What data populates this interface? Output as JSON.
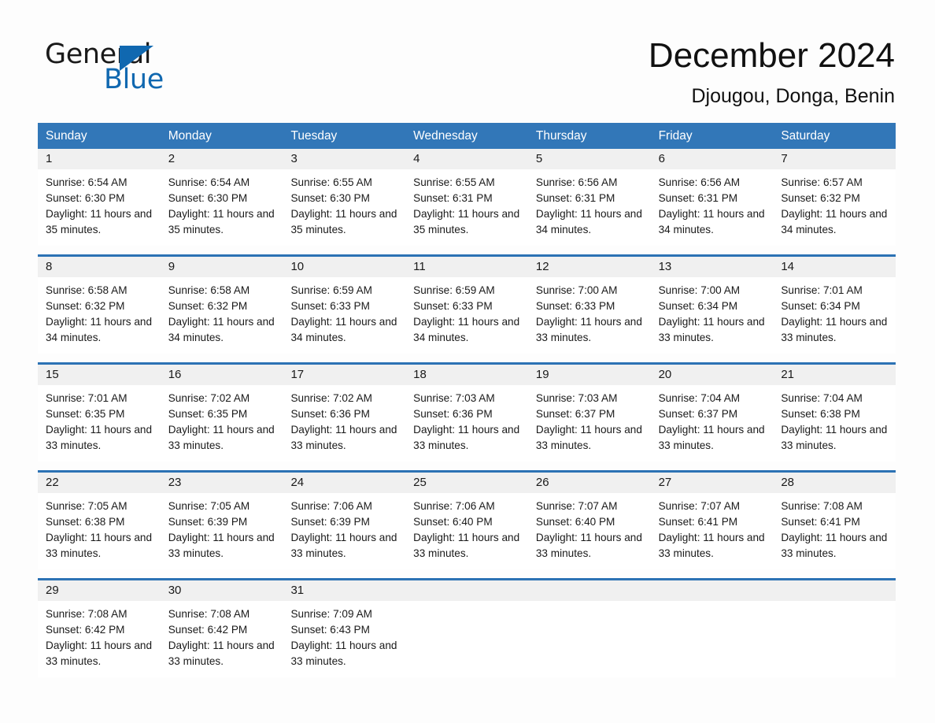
{
  "brand": {
    "word_one": "General",
    "word_two": "Blue",
    "triangle_color": "#1068b0"
  },
  "header": {
    "title": "December 2024",
    "subtitle": "Djougou, Donga, Benin",
    "header_color": "#3277b8"
  },
  "calendar": {
    "weekdays": [
      "Sunday",
      "Monday",
      "Tuesday",
      "Wednesday",
      "Thursday",
      "Friday",
      "Saturday"
    ],
    "weeks": [
      [
        {
          "day": "1",
          "sunrise": "Sunrise: 6:54 AM",
          "sunset": "Sunset: 6:30 PM",
          "daylight": "Daylight: 11 hours and 35 minutes."
        },
        {
          "day": "2",
          "sunrise": "Sunrise: 6:54 AM",
          "sunset": "Sunset: 6:30 PM",
          "daylight": "Daylight: 11 hours and 35 minutes."
        },
        {
          "day": "3",
          "sunrise": "Sunrise: 6:55 AM",
          "sunset": "Sunset: 6:30 PM",
          "daylight": "Daylight: 11 hours and 35 minutes."
        },
        {
          "day": "4",
          "sunrise": "Sunrise: 6:55 AM",
          "sunset": "Sunset: 6:31 PM",
          "daylight": "Daylight: 11 hours and 35 minutes."
        },
        {
          "day": "5",
          "sunrise": "Sunrise: 6:56 AM",
          "sunset": "Sunset: 6:31 PM",
          "daylight": "Daylight: 11 hours and 34 minutes."
        },
        {
          "day": "6",
          "sunrise": "Sunrise: 6:56 AM",
          "sunset": "Sunset: 6:31 PM",
          "daylight": "Daylight: 11 hours and 34 minutes."
        },
        {
          "day": "7",
          "sunrise": "Sunrise: 6:57 AM",
          "sunset": "Sunset: 6:32 PM",
          "daylight": "Daylight: 11 hours and 34 minutes."
        }
      ],
      [
        {
          "day": "8",
          "sunrise": "Sunrise: 6:58 AM",
          "sunset": "Sunset: 6:32 PM",
          "daylight": "Daylight: 11 hours and 34 minutes."
        },
        {
          "day": "9",
          "sunrise": "Sunrise: 6:58 AM",
          "sunset": "Sunset: 6:32 PM",
          "daylight": "Daylight: 11 hours and 34 minutes."
        },
        {
          "day": "10",
          "sunrise": "Sunrise: 6:59 AM",
          "sunset": "Sunset: 6:33 PM",
          "daylight": "Daylight: 11 hours and 34 minutes."
        },
        {
          "day": "11",
          "sunrise": "Sunrise: 6:59 AM",
          "sunset": "Sunset: 6:33 PM",
          "daylight": "Daylight: 11 hours and 34 minutes."
        },
        {
          "day": "12",
          "sunrise": "Sunrise: 7:00 AM",
          "sunset": "Sunset: 6:33 PM",
          "daylight": "Daylight: 11 hours and 33 minutes."
        },
        {
          "day": "13",
          "sunrise": "Sunrise: 7:00 AM",
          "sunset": "Sunset: 6:34 PM",
          "daylight": "Daylight: 11 hours and 33 minutes."
        },
        {
          "day": "14",
          "sunrise": "Sunrise: 7:01 AM",
          "sunset": "Sunset: 6:34 PM",
          "daylight": "Daylight: 11 hours and 33 minutes."
        }
      ],
      [
        {
          "day": "15",
          "sunrise": "Sunrise: 7:01 AM",
          "sunset": "Sunset: 6:35 PM",
          "daylight": "Daylight: 11 hours and 33 minutes."
        },
        {
          "day": "16",
          "sunrise": "Sunrise: 7:02 AM",
          "sunset": "Sunset: 6:35 PM",
          "daylight": "Daylight: 11 hours and 33 minutes."
        },
        {
          "day": "17",
          "sunrise": "Sunrise: 7:02 AM",
          "sunset": "Sunset: 6:36 PM",
          "daylight": "Daylight: 11 hours and 33 minutes."
        },
        {
          "day": "18",
          "sunrise": "Sunrise: 7:03 AM",
          "sunset": "Sunset: 6:36 PM",
          "daylight": "Daylight: 11 hours and 33 minutes."
        },
        {
          "day": "19",
          "sunrise": "Sunrise: 7:03 AM",
          "sunset": "Sunset: 6:37 PM",
          "daylight": "Daylight: 11 hours and 33 minutes."
        },
        {
          "day": "20",
          "sunrise": "Sunrise: 7:04 AM",
          "sunset": "Sunset: 6:37 PM",
          "daylight": "Daylight: 11 hours and 33 minutes."
        },
        {
          "day": "21",
          "sunrise": "Sunrise: 7:04 AM",
          "sunset": "Sunset: 6:38 PM",
          "daylight": "Daylight: 11 hours and 33 minutes."
        }
      ],
      [
        {
          "day": "22",
          "sunrise": "Sunrise: 7:05 AM",
          "sunset": "Sunset: 6:38 PM",
          "daylight": "Daylight: 11 hours and 33 minutes."
        },
        {
          "day": "23",
          "sunrise": "Sunrise: 7:05 AM",
          "sunset": "Sunset: 6:39 PM",
          "daylight": "Daylight: 11 hours and 33 minutes."
        },
        {
          "day": "24",
          "sunrise": "Sunrise: 7:06 AM",
          "sunset": "Sunset: 6:39 PM",
          "daylight": "Daylight: 11 hours and 33 minutes."
        },
        {
          "day": "25",
          "sunrise": "Sunrise: 7:06 AM",
          "sunset": "Sunset: 6:40 PM",
          "daylight": "Daylight: 11 hours and 33 minutes."
        },
        {
          "day": "26",
          "sunrise": "Sunrise: 7:07 AM",
          "sunset": "Sunset: 6:40 PM",
          "daylight": "Daylight: 11 hours and 33 minutes."
        },
        {
          "day": "27",
          "sunrise": "Sunrise: 7:07 AM",
          "sunset": "Sunset: 6:41 PM",
          "daylight": "Daylight: 11 hours and 33 minutes."
        },
        {
          "day": "28",
          "sunrise": "Sunrise: 7:08 AM",
          "sunset": "Sunset: 6:41 PM",
          "daylight": "Daylight: 11 hours and 33 minutes."
        }
      ],
      [
        {
          "day": "29",
          "sunrise": "Sunrise: 7:08 AM",
          "sunset": "Sunset: 6:42 PM",
          "daylight": "Daylight: 11 hours and 33 minutes."
        },
        {
          "day": "30",
          "sunrise": "Sunrise: 7:08 AM",
          "sunset": "Sunset: 6:42 PM",
          "daylight": "Daylight: 11 hours and 33 minutes."
        },
        {
          "day": "31",
          "sunrise": "Sunrise: 7:09 AM",
          "sunset": "Sunset: 6:43 PM",
          "daylight": "Daylight: 11 hours and 33 minutes."
        },
        {
          "day": "",
          "sunrise": "",
          "sunset": "",
          "daylight": ""
        },
        {
          "day": "",
          "sunrise": "",
          "sunset": "",
          "daylight": ""
        },
        {
          "day": "",
          "sunrise": "",
          "sunset": "",
          "daylight": ""
        },
        {
          "day": "",
          "sunrise": "",
          "sunset": "",
          "daylight": ""
        }
      ]
    ]
  }
}
